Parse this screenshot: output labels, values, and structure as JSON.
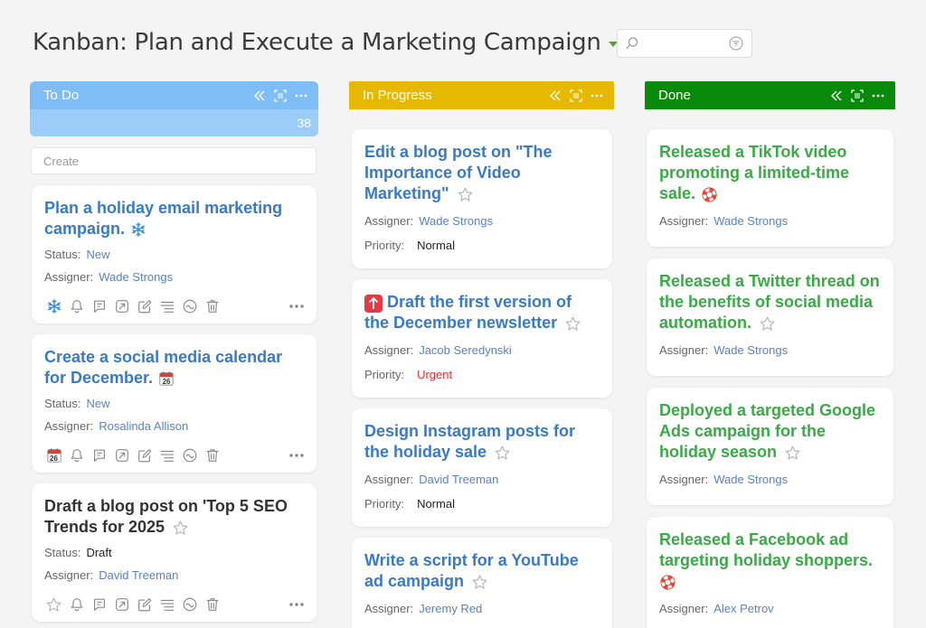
{
  "page": {
    "title": "Kanban: Plan and Execute a Marketing Campaign"
  },
  "search": {
    "placeholder": ""
  },
  "colors": {
    "todo": "#7ebdf5",
    "todo_count": "#9cccf8",
    "inprogress": "#e6b800",
    "done": "#0a8a0a"
  },
  "columns": {
    "todo": {
      "title": "To Do",
      "count": "38",
      "create_placeholder": "Create"
    },
    "inprogress": {
      "title": "In Progress"
    },
    "done": {
      "title": "Done"
    }
  },
  "labels": {
    "status": "Status:",
    "assigner": "Assigner:",
    "priority": "Priority:"
  },
  "todo_cards": [
    {
      "title": "Plan a holiday email marketing campaign.",
      "icon": "snowflake-icon",
      "status": "New",
      "assigner": "Wade Strongs"
    },
    {
      "title": "Create a social media calendar for December.",
      "icon": "calendar-icon",
      "calendar_day": "26",
      "status": "New",
      "assigner": "Rosalinda Allison"
    },
    {
      "title": "Draft a blog post on 'Top 5 SEO Trends for 2025",
      "icon": "star-icon",
      "status": "Draft",
      "assigner": "David Treeman"
    }
  ],
  "progress_cards": [
    {
      "title": "Edit a blog post on \"The Importance of Video Marketing\"",
      "assigner": "Wade Strongs",
      "priority": "Normal"
    },
    {
      "title": "Draft the first version of the December newsletter",
      "assigner": "Jacob Seredynski",
      "priority": "Urgent"
    },
    {
      "title": "Design Instagram posts for the holiday sale",
      "assigner": "David Treeman",
      "priority": "Normal"
    },
    {
      "title": "Write a script for a YouTube ad campaign",
      "assigner": "Jeremy Red"
    }
  ],
  "done_cards": [
    {
      "title": "Released a TikTok video promoting a limited-time sale.",
      "icon": "lifebuoy-icon",
      "assigner": "Wade Strongs"
    },
    {
      "title": "Released a Twitter thread on the benefits of social media automation.",
      "icon": "star-icon",
      "assigner": "Wade Strongs"
    },
    {
      "title": "Deployed a targeted Google Ads campaign for the holiday season",
      "icon": "star-icon",
      "assigner": "Wade Strongs"
    },
    {
      "title": "Released a Facebook ad targeting holiday shoppers.",
      "icon": "lifebuoy-icon",
      "assigner": "Alex Petrov"
    }
  ]
}
